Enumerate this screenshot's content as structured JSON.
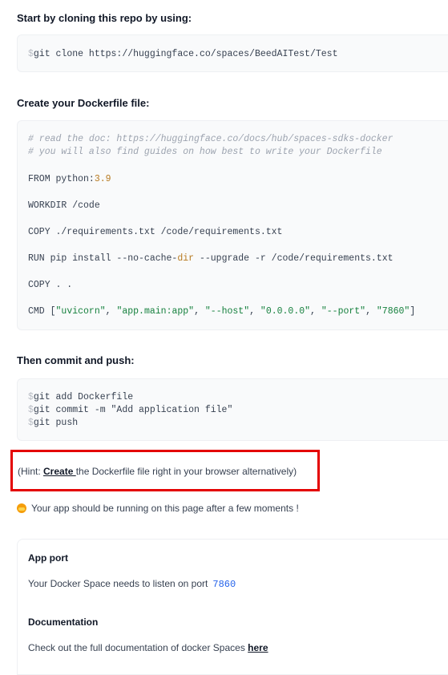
{
  "clone": {
    "heading": "Start by cloning this repo by using:",
    "prompt": "$",
    "command": "git clone https://huggingface.co/spaces/BeedAITest/Test"
  },
  "dockerfile": {
    "heading": "Create your Dockerfile file:",
    "comment1": "# read the doc: https://huggingface.co/docs/hub/spaces-sdks-docker",
    "comment2": "# you will also find guides on how best to write your Dockerfile",
    "from_kw": "FROM python:",
    "from_ver": "3.9",
    "workdir": "WORKDIR /code",
    "copy_req": "COPY ./requirements.txt /code/requirements.txt",
    "run_a": "RUN pip install --no-cache-",
    "run_dir": "dir",
    "run_b": " --upgrade -r /code/requirements.txt",
    "copy_all": "COPY . .",
    "cmd_prefix": "CMD [",
    "cmd_args": [
      "\"uvicorn\"",
      "\"app.main:app\"",
      "\"--host\"",
      "\"0.0.0.0\"",
      "\"--port\"",
      "\"7860\""
    ],
    "sep": ", ",
    "cmd_suffix": "]"
  },
  "commit": {
    "heading": "Then commit and push:",
    "prompt": "$",
    "cmd1": "git add Dockerfile",
    "cmd2": "git commit -m \"Add application file\"",
    "cmd3": "git push"
  },
  "hint": {
    "prefix": "(Hint: ",
    "link": "Create ",
    "suffix": "the Dockerfile file right in your browser alternatively)"
  },
  "running_text": "Your app should be running on this page after a few moments !",
  "running_icon": "hugging-face-icon",
  "info": {
    "app_port_heading": "App port",
    "app_port_text": "Your Docker Space needs to listen on port",
    "port": "7860",
    "doc_heading": "Documentation",
    "doc_text": "Check out the full documentation of docker Spaces ",
    "doc_link": "here"
  }
}
